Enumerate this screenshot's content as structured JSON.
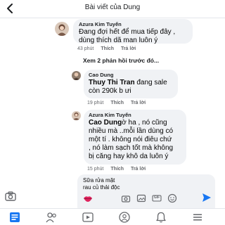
{
  "header": {
    "title": "Bài viết của Dung",
    "back_icon": "chevron-left-icon"
  },
  "comments": [
    {
      "author": "Azura Kim Tuyến",
      "lines": [
        "Đang đợi hết để mua tiếp đây ,",
        "dùng thích dã man luôn ý"
      ],
      "time": "43 phút",
      "like": "Thích",
      "reply": "Trả lời"
    }
  ],
  "more_replies": "Xem 2 phản hồi trước đó...",
  "replies": [
    {
      "author": "Cao Dung",
      "mention": "Thuy Thi Tran",
      "first_line_rest": " đang sale",
      "lines": [
        "còn 290k b ưi"
      ],
      "time": "19 phút",
      "like": "Thích",
      "reply": "Trả lời"
    },
    {
      "author": "Azura Kim Tuyến",
      "mention": "Cao Dung",
      "first_line_rest": "ờ ha , nó cũng",
      "lines": [
        "nhiều mà ..mỗi lần dùng có",
        "một tí . không nói điêu chứ",
        ", nó làm sạch tốt mà không",
        "bị căng hay khô da luôn ý"
      ],
      "time": "15 phút",
      "like": "Thích",
      "reply": "Trả lời"
    }
  ],
  "composer": {
    "draft_lines": [
      "Sữa rửa mặt",
      "rau củ thải độc"
    ],
    "icons": [
      "lips-emoji-icon",
      "camera-icon",
      "image-icon",
      "gif-icon",
      "smiley-icon",
      "send-icon"
    ],
    "gif_label": "GIF"
  },
  "bottom_nav": {
    "icons": [
      "news-feed-icon",
      "friends-icon",
      "watch-icon",
      "groups-icon",
      "notifications-icon",
      "menu-icon"
    ]
  },
  "colors": {
    "accent": "#1877f2",
    "bubble": "#f0f2f5",
    "meta": "#65676b"
  }
}
